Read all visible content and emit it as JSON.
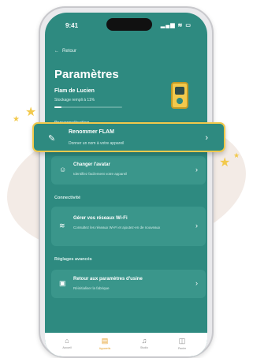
{
  "status_bar": {
    "time": "9:41",
    "icons": "▂▄▆ ≋ ▭"
  },
  "header": {
    "back_label": "Retour",
    "title": "Paramètres"
  },
  "device": {
    "name": "Flam de Lucien",
    "storage_label": "Stockage rempli à 11%",
    "storage_fraction": 0.11
  },
  "sections": {
    "personnalisation": "Personnalisation",
    "connectivite": "Connectivité",
    "reglages": "Réglages avancés"
  },
  "items": {
    "rename": {
      "title": "Renommer FLAM",
      "subtitle": "Donner un nom à votre appareil",
      "icon": "pencil-icon"
    },
    "avatar": {
      "title": "Changer l'avatar",
      "subtitle": "Identifiez facilement votre appareil",
      "icon": "avatar-icon"
    },
    "wifi": {
      "title": "Gérer vos réseaux Wi-Fi",
      "subtitle": "Consultez les réseaux Wi-Fi et ajoutez-en de nouveaux",
      "icon": "wifi-icon"
    },
    "reset": {
      "title": "Retour aux paramètres d'usine",
      "subtitle": "Réinitialiser la fabrique",
      "icon": "reset-icon"
    }
  },
  "tabs": [
    {
      "label": "Accueil",
      "icon": "home-icon",
      "active": false
    },
    {
      "label": "Appareils",
      "icon": "device-icon",
      "active": true
    },
    {
      "label": "Studio",
      "icon": "mic-icon",
      "active": false
    },
    {
      "label": "Panier",
      "icon": "bag-icon",
      "active": false
    }
  ],
  "colors": {
    "primary": "#2e8a80",
    "accent": "#f2c94c",
    "active_tab": "#e5a12d"
  }
}
